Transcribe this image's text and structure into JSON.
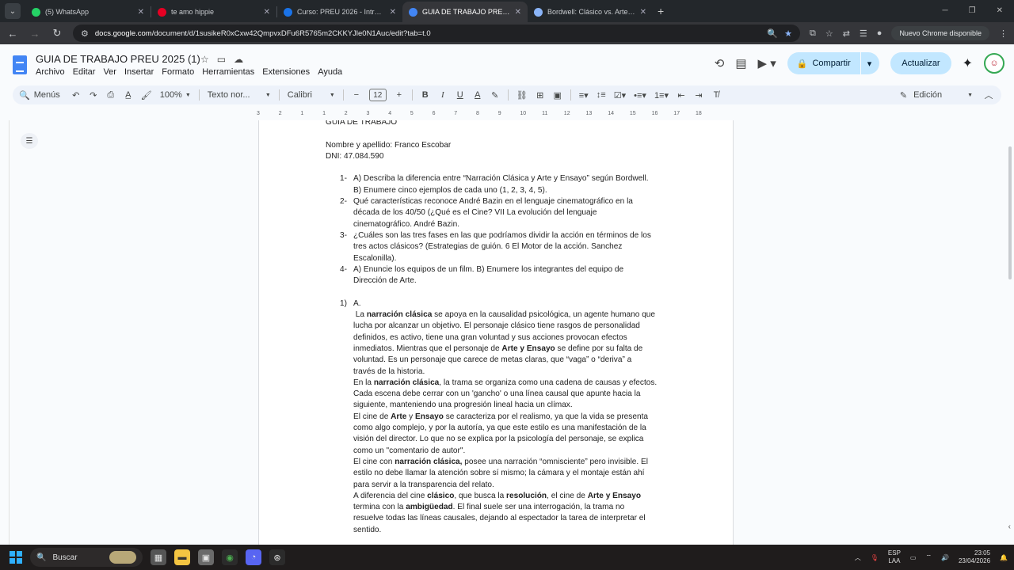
{
  "browser": {
    "tabs": [
      {
        "title": "(5) WhatsApp",
        "icon": "whatsapp-icon",
        "color": "#25d366",
        "active": false
      },
      {
        "title": "te amo hippie",
        "icon": "pinterest-icon",
        "color": "#e60023",
        "active": false
      },
      {
        "title": "Curso: PREU 2026 - Introducció",
        "icon": "moodle-icon",
        "color": "#1a73e8",
        "active": false
      },
      {
        "title": "GUIA DE TRABAJO PREU 2025 (",
        "icon": "google-docs-icon",
        "color": "#4285f4",
        "active": true
      },
      {
        "title": "Bordwell: Clásico vs. Arte y Ens...",
        "icon": "gemini-icon",
        "color": "#8ab4f8",
        "active": false
      }
    ],
    "new_tab": "+",
    "url_host": "docs.google.com",
    "url_path": "/document/d/1susikeR0xCxw42QmpvxDFu6R5765m2CKKYJle0N1Auc/edit?tab=t.0",
    "update_label": "Nuevo Chrome disponible"
  },
  "docs": {
    "title": "GUIA DE TRABAJO PREU 2025 (1)",
    "menu": [
      "Archivo",
      "Editar",
      "Ver",
      "Insertar",
      "Formato",
      "Herramientas",
      "Extensiones",
      "Ayuda"
    ],
    "share_label": "Compartir",
    "update_label": "Actualizar",
    "avatar_label": "☺"
  },
  "toolbar": {
    "menus_label": "Menús",
    "zoom": "100%",
    "style": "Texto nor...",
    "font": "Calibri",
    "font_size": "12",
    "mode": "Edición"
  },
  "ruler": [
    "3",
    "2",
    "1",
    "1",
    "2",
    "3",
    "4",
    "5",
    "6",
    "7",
    "8",
    "9",
    "10",
    "11",
    "12",
    "13",
    "14",
    "15",
    "16",
    "17",
    "18"
  ],
  "document": {
    "heading_partial": "GUIA DE TRABAJO",
    "name_line": "Nombre y apellido: Franco Escobar",
    "dni_line": "DNI: 47.084.590",
    "questions": [
      {
        "num": "1-",
        "lines": [
          "A) Describa la diferencia entre “Narración Clásica y Arte y Ensayo” según Bordwell.",
          "B) Enumere cinco ejemplos de cada uno (1, 2, 3, 4, 5)."
        ]
      },
      {
        "num": "2-",
        "lines": [
          "Qué características reconoce André Bazin en el lenguaje cinematográfico en la",
          "década de los 40/50 (¿Qué es el Cine? VII La evolución del lenguaje",
          "cinematográfico. André Bazin."
        ]
      },
      {
        "num": "3-",
        "lines": [
          "¿Cuáles son las tres fases en las que podríamos dividir la acción en términos de los",
          "tres actos clásicos? (Estrategias de guión. 6 El Motor de la acción. Sanchez",
          "Escalonilla)."
        ]
      },
      {
        "num": "4-",
        "lines": [
          "A) Enuncie los equipos de un film. B) Enumere los integrantes del equipo de",
          "Dirección de Arte."
        ]
      }
    ],
    "answer_num": "1)",
    "answer_letter": "A.",
    "answer_lines": [
      [
        " La ",
        {
          "b": "narración clásica"
        },
        " se apoya en la causalidad psicológica, un agente humano que"
      ],
      [
        "lucha por alcanzar un objetivo. El personaje clásico tiene rasgos de personalidad"
      ],
      [
        "definidos, es activo, tiene una gran voluntad y sus acciones provocan efectos"
      ],
      [
        "inmediatos. Mientras que el personaje de ",
        {
          "b": "Arte y Ensayo"
        },
        " se define por su falta de"
      ],
      [
        "voluntad. Es un personaje que carece de metas claras, que “vaga” o “deriva” a"
      ],
      [
        "través de la historia."
      ],
      [
        "En la ",
        {
          "b": "narración clásica"
        },
        ", la trama se organiza como una cadena de causas y efectos."
      ],
      [
        "Cada escena debe cerrar con un 'gancho' o una línea causal que apunte hacia la"
      ],
      [
        "siguiente, manteniendo una progresión lineal hacia un clímax."
      ],
      [
        "El cine de ",
        {
          "b": "Arte"
        },
        " y ",
        {
          "b": "Ensayo"
        },
        " se caracteriza por el realismo, ya que la vida se presenta"
      ],
      [
        "como algo complejo, y por la autoría, ya que este estilo es una manifestación de la"
      ],
      [
        "visión del director. Lo que no se explica por la psicología del personaje, se explica"
      ],
      [
        "como un \"comentario de autor\"."
      ],
      [
        "El cine con ",
        {
          "b": "narración clásica,"
        },
        " posee una narración “omnisciente” pero invisible. El"
      ],
      [
        "estilo no debe llamar la atención sobre sí mismo; la cámara y el montaje están ahí"
      ],
      [
        "para servir a la transparencia del relato."
      ],
      [
        "A diferencia del cine ",
        {
          "b": "clásico"
        },
        ", que busca la ",
        {
          "b": "resolución"
        },
        ", el cine de ",
        {
          "b": "Arte y Ensayo"
        }
      ],
      [
        "termina con la ",
        {
          "b": "ambigüedad"
        },
        ". El final suele ser una interrogación, la trama no"
      ],
      [
        "resuelve todas las líneas causales, dejando al espectador la tarea de interpretar el"
      ],
      [
        "sentido."
      ]
    ]
  },
  "taskbar": {
    "search_label": "Buscar",
    "lang_top": "ESP",
    "lang_bottom": "LAA",
    "time": "23:05",
    "date": "23/04/2026"
  }
}
